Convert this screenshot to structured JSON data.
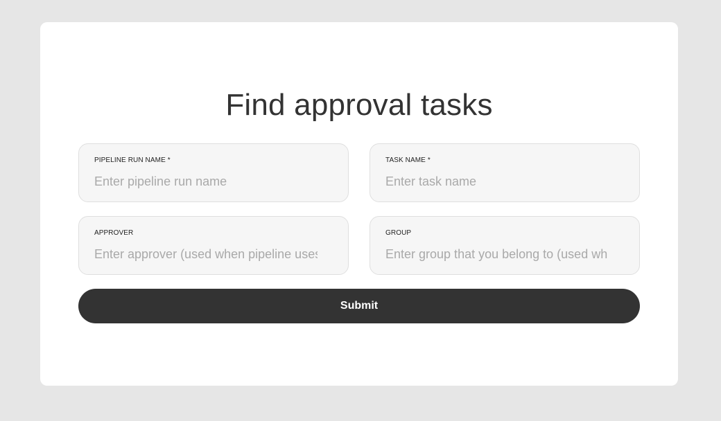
{
  "form": {
    "title": "Find approval tasks",
    "fields": [
      {
        "label": "Pipeline run name *",
        "value": "",
        "placeholder": "Enter pipeline run name"
      },
      {
        "label": "Task name *",
        "value": "",
        "placeholder": "Enter task name"
      },
      {
        "label": "Approver",
        "value": "",
        "placeholder": "Enter approver (used when pipeline uses"
      },
      {
        "label": "Group",
        "value": "",
        "placeholder": "Enter group that you belong to (used wh"
      }
    ],
    "submit_label": "Submit"
  }
}
